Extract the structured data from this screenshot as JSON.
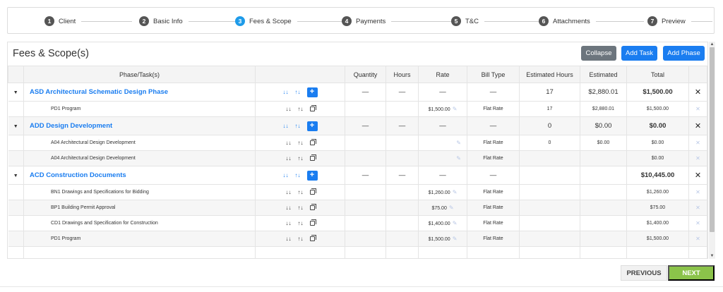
{
  "stepper": [
    {
      "num": "1",
      "label": "Client"
    },
    {
      "num": "2",
      "label": "Basic Info"
    },
    {
      "num": "3",
      "label": "Fees & Scope"
    },
    {
      "num": "4",
      "label": "Payments"
    },
    {
      "num": "5",
      "label": "T&C"
    },
    {
      "num": "6",
      "label": "Attachments"
    },
    {
      "num": "7",
      "label": "Preview"
    }
  ],
  "panel": {
    "title": "Fees & Scope(s)",
    "collapse_label": "Collapse",
    "add_task_label": "Add Task",
    "add_phase_label": "Add Phase"
  },
  "columns": [
    "Phase/Task(s)",
    "",
    "Quantity",
    "Hours",
    "Rate",
    "Bill Type",
    "Estimated Hours",
    "Estimated",
    "Total"
  ],
  "rows": {
    "r0": {
      "name": "ASD Architectural Schematic Design Phase",
      "qty": "—",
      "hours": "—",
      "rate": "—",
      "bill": "—",
      "est_hours": "17",
      "estimated": "$2,880.01",
      "total": "$1,500.00"
    },
    "r1": {
      "name": "PD1 Program",
      "rate": "$1,500.00",
      "bill": "Flat Rate",
      "est_hours": "17",
      "estimated": "$2,880.01",
      "total": "$1,500.00"
    },
    "r2": {
      "name": "ADD Design Development",
      "qty": "—",
      "hours": "—",
      "rate": "—",
      "bill": "—",
      "est_hours": "0",
      "estimated": "$0.00",
      "total": "$0.00"
    },
    "r3": {
      "name": "A04 Architectural Design Development",
      "bill": "Flat Rate",
      "est_hours": "0",
      "estimated": "$0.00",
      "total": "$0.00"
    },
    "r4": {
      "name": "A04 Architectural Design Development",
      "bill": "Flat Rate",
      "total": "$0.00"
    },
    "r5": {
      "name": "ACD Construction Documents",
      "qty": "—",
      "hours": "—",
      "rate": "—",
      "bill": "—",
      "total": "$10,445.00"
    },
    "r6": {
      "name": "BN1 Drawings and Specifications for Bidding",
      "rate": "$1,260.00",
      "bill": "Flat Rate",
      "total": "$1,260.00"
    },
    "r7": {
      "name": "BP1 Building Permit Approval",
      "rate": "$75.00",
      "bill": "Flat Rate",
      "total": "$75.00"
    },
    "r8": {
      "name": "CD1 Drawings and Specification for Construction",
      "rate": "$1,400.00",
      "bill": "Flat Rate",
      "total": "$1,400.00"
    },
    "r9": {
      "name": "PD1 Program",
      "rate": "$1,500.00",
      "bill": "Flat Rate",
      "total": "$1,500.00"
    }
  },
  "symbols": {
    "caret": "▼",
    "close_big": "✕",
    "close_small": "✕",
    "pencil": "✎",
    "sort_desc": "↓↓",
    "sort_asc": "↑↓",
    "plus": "+",
    "scroll_up": "▲",
    "scroll_down": "▼"
  },
  "footer": {
    "previous_label": "PREVIOUS",
    "next_label": "NEXT"
  },
  "colors": {
    "accent": "#1a7df0",
    "active_step": "#1e9be9",
    "next_button": "#8bc34a",
    "collapse_button": "#6c757d"
  }
}
